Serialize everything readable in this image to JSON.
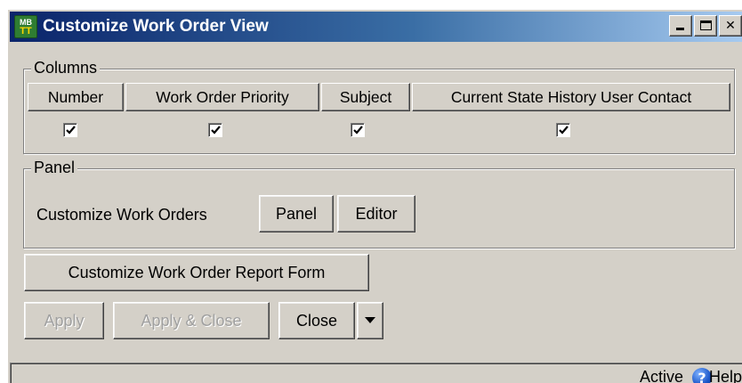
{
  "window": {
    "title": "Customize Work Order View",
    "icon_top": "MB",
    "icon_bottom": "TT",
    "minimize_label": "",
    "maximize_label": "",
    "close_label": "✕"
  },
  "columns_group": {
    "label": "Columns",
    "headers": [
      "Number",
      "Work Order Priority",
      "Subject",
      "Current State History User Contact"
    ],
    "checked": [
      true,
      true,
      true,
      true
    ]
  },
  "panel_group": {
    "label": "Panel",
    "text": "Customize Work Orders",
    "panel_button": "Panel",
    "editor_button": "Editor"
  },
  "report_form_button": "Customize Work Order Report Form",
  "actions": {
    "apply": "Apply",
    "apply_close": "Apply & Close",
    "close": "Close",
    "dropdown_icon": "dropdown-arrow-icon"
  },
  "status": {
    "state": "Active",
    "help": "Help",
    "help_icon": "help-icon"
  },
  "colors": {
    "title_start": "#0a246a",
    "title_end": "#a6caf0",
    "face": "#d4d0c8"
  }
}
